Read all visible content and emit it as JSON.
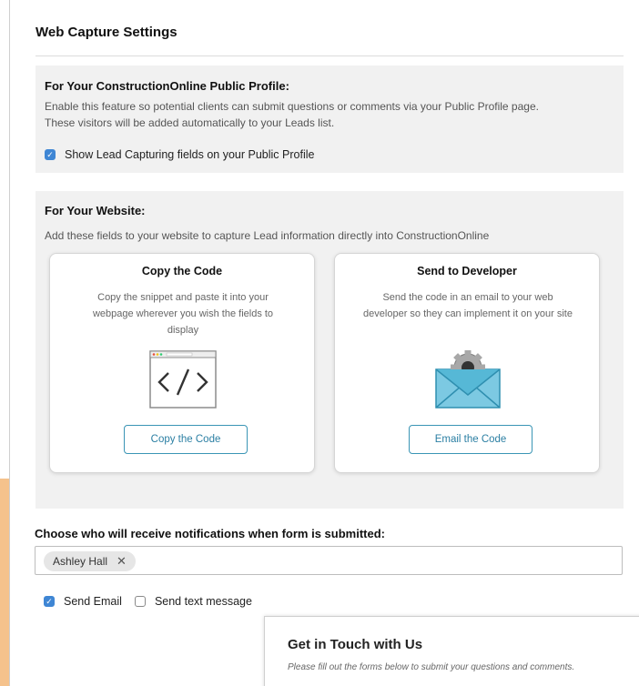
{
  "page": {
    "title": "Web Capture Settings"
  },
  "public_profile": {
    "heading": "For Your ConstructionOnline Public Profile:",
    "description_line1": "Enable this feature so potential clients can submit questions or comments via your Public Profile page.",
    "description_line2": "These visitors will be added automatically to your Leads list.",
    "checkbox_label": "Show Lead Capturing fields on your Public Profile"
  },
  "website": {
    "heading": "For Your Website:",
    "description": "Add these fields to your website to capture Lead information directly into ConstructionOnline",
    "copy_card": {
      "title": "Copy the Code",
      "description": "Copy the snippet and paste it into your webpage wherever you wish the fields to display",
      "icon": "code-window-icon",
      "button_label": "Copy the Code"
    },
    "send_card": {
      "title": "Send to Developer",
      "description": "Send the code in an email to your web developer so they can implement it on your site",
      "icon": "email-gear-icon",
      "button_label": "Email the Code"
    }
  },
  "notifications": {
    "heading": "Choose who will receive notifications when form is submitted:",
    "recipients": [
      {
        "name": "Ashley Hall",
        "remove_symbol": "✕"
      }
    ],
    "send_email_label": "Send Email",
    "send_text_label": "Send text message"
  },
  "preview": {
    "title": "Get in Touch with Us",
    "subtitle": "Please fill out the forms below to submit your questions and comments."
  },
  "colors": {
    "accent_strip": "#f5c28c",
    "checkbox_blue": "#3f86d4",
    "button_teal": "#3a95b5",
    "envelope": "#56b8d6",
    "gear": "#9a9a9a"
  }
}
